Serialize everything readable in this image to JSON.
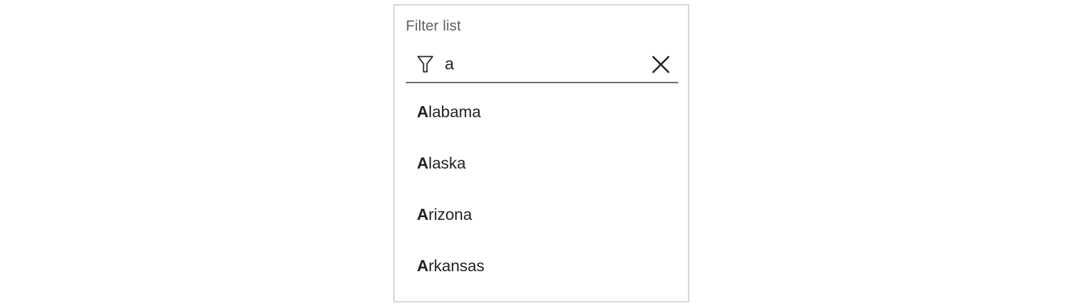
{
  "filter": {
    "title": "Filter list",
    "value": "a",
    "icon": "filter-icon",
    "clear_icon": "close-icon"
  },
  "results": [
    {
      "match": "A",
      "rest": "labama"
    },
    {
      "match": "A",
      "rest": "laska"
    },
    {
      "match": "A",
      "rest": "rizona"
    },
    {
      "match": "A",
      "rest": "rkansas"
    }
  ],
  "colors": {
    "border": "#d6d6d6",
    "underline": "#6d6d6d",
    "title": "#5f5f5f",
    "text": "#222222"
  }
}
